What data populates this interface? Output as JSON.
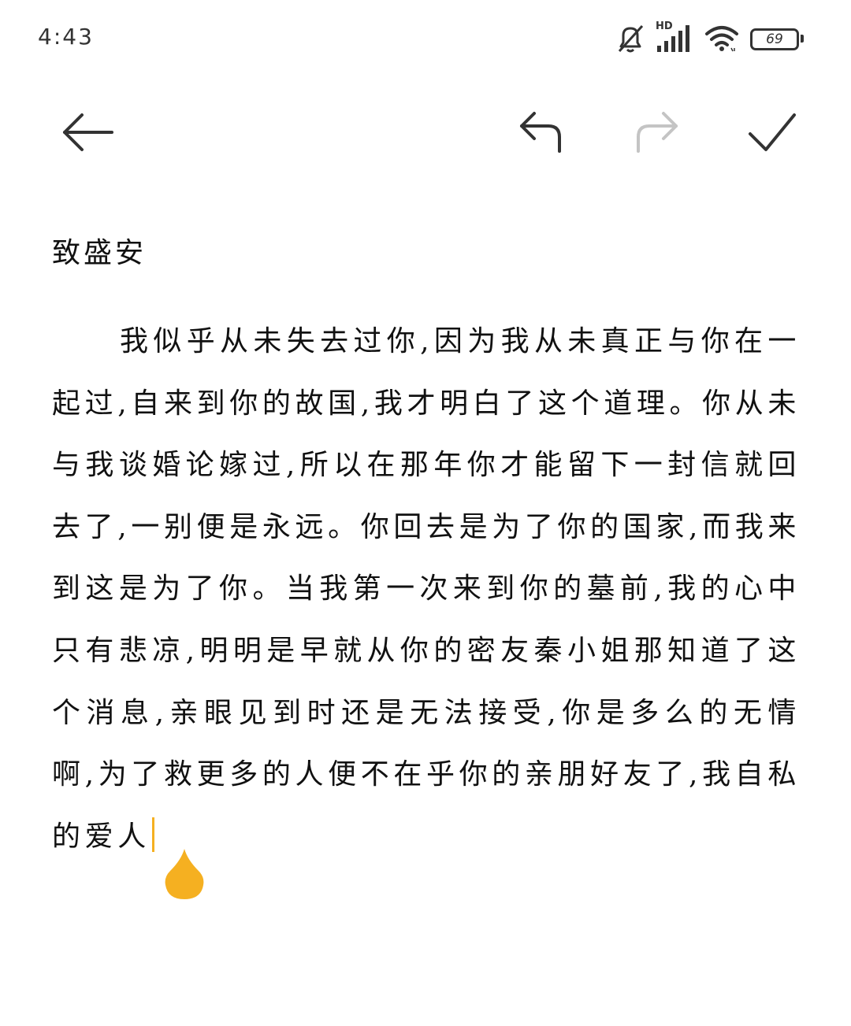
{
  "status_bar": {
    "time": "4:43",
    "network_label": "HD",
    "battery_level": "69",
    "icons": [
      "bell-muted-icon",
      "signal-icon",
      "wifi-icon",
      "battery-icon"
    ]
  },
  "toolbar": {
    "icons": [
      "arrow-left-icon",
      "undo-icon",
      "redo-icon",
      "checkmark-icon"
    ],
    "redo_enabled": false
  },
  "note": {
    "title": "致盛安",
    "body": "我似乎从未失去过你,因为我从未真正与你在一起过,自来到你的故国,我才明白了这个道理。你从未与我谈婚论嫁过,所以在那年你才能留下一封信就回去了,一别便是永远。你回去是为了你的国家,而我来到这是为了你。当我第一次来到你的墓前,我的心中只有悲凉,明明是早就从你的密友秦小姐那知道了这个消息,亲眼见到时还是无法接受,你是多么的无情啊,为了救更多的人便不在乎你的亲朋好友了,我自私的爱人"
  },
  "colors": {
    "text": "#111111",
    "icon": "#333333",
    "icon_disabled": "#c4c4c4",
    "cursor_accent": "#f5b021",
    "background": "#ffffff"
  }
}
